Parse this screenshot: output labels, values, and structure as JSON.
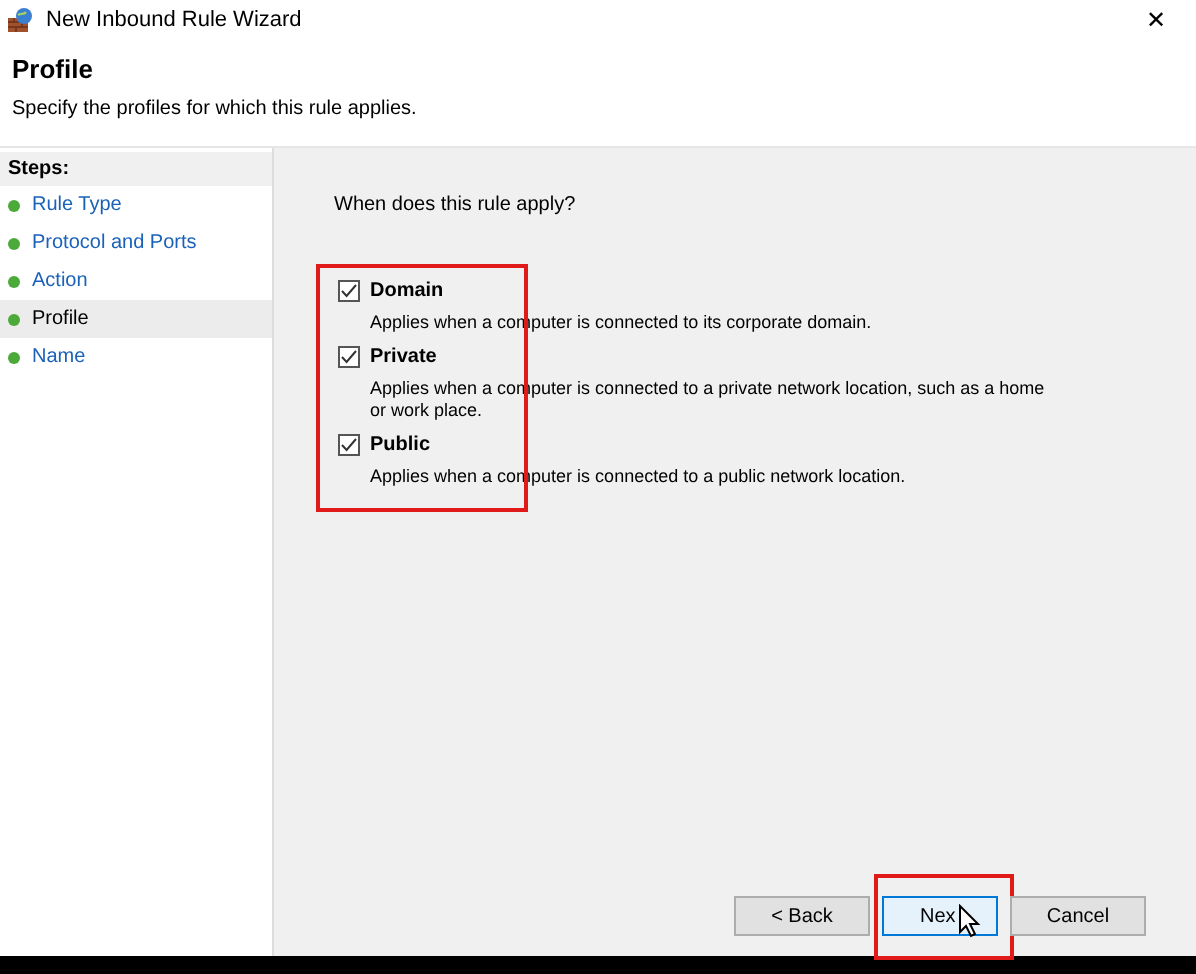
{
  "window": {
    "title": "New Inbound Rule Wizard",
    "close": "✕"
  },
  "header": {
    "title": "Profile",
    "subtitle": "Specify the profiles for which this rule applies."
  },
  "steps": {
    "title": "Steps:",
    "items": [
      {
        "label": "Rule Type",
        "selected": false
      },
      {
        "label": "Protocol and Ports",
        "selected": false
      },
      {
        "label": "Action",
        "selected": false
      },
      {
        "label": "Profile",
        "selected": true
      },
      {
        "label": "Name",
        "selected": false
      }
    ]
  },
  "question": "When does this rule apply?",
  "profiles": {
    "highlighted": true,
    "items": [
      {
        "label": "Domain",
        "checked": true,
        "description": "Applies when a computer is connected to its corporate domain."
      },
      {
        "label": "Private",
        "checked": true,
        "description": "Applies when a computer is connected to a private network location, such as a home or work place."
      },
      {
        "label": "Public",
        "checked": true,
        "description": "Applies when a computer is connected to a public network location."
      }
    ]
  },
  "buttons": [
    {
      "label": "< Back",
      "kind": "back",
      "highlighted": false
    },
    {
      "label": "Nex",
      "kind": "next",
      "highlighted": true
    },
    {
      "label": "Cancel",
      "kind": "cancel",
      "highlighted": false
    }
  ]
}
